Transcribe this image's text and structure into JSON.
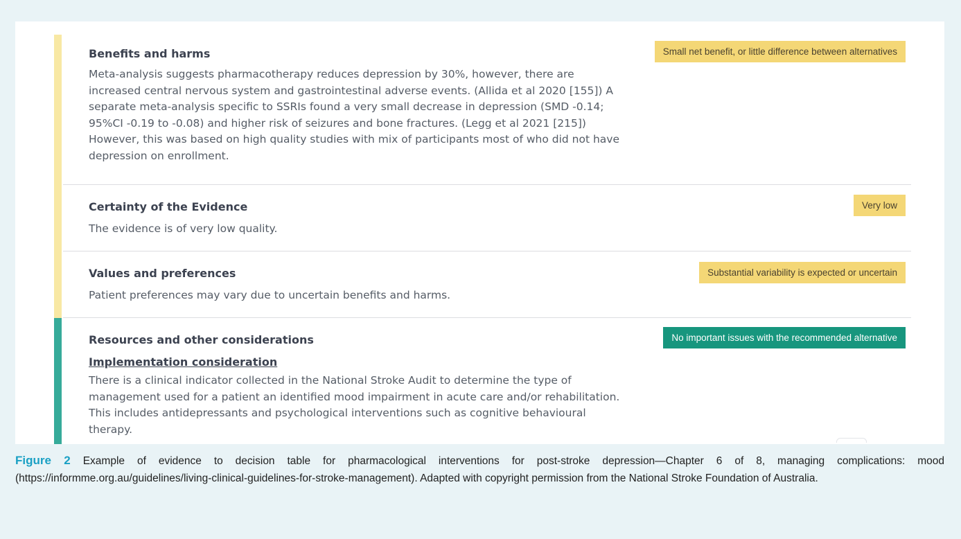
{
  "colors": {
    "yellow_bar": "#f8e8a4",
    "teal_bar": "#36ab9a",
    "yellow_badge": "#f4d776",
    "teal_badge": "#17967e",
    "caption_label": "#1aa0c4"
  },
  "sections": [
    {
      "title": "Benefits and harms",
      "badge": "Small net benefit, or little difference between alternatives",
      "body": "Meta-analysis suggests pharmacotherapy reduces depression by 30%, however, there are increased central nervous system and gastrointestinal adverse events. (Allida et al 2020 [155]) A separate meta-analysis specific to SSRIs found a very small decrease in depression (SMD -0.14; 95%CI -0.19 to -0.08) and higher risk of seizures and bone fractures. (Legg et al 2021 [215]) However, this was based on high quality studies with mix of participants most of who did not have depression on enrollment."
    },
    {
      "title": "Certainty of the Evidence",
      "badge": "Very low",
      "body": "The evidence is of very low quality."
    },
    {
      "title": "Values and preferences",
      "badge": "Substantial variability is expected or uncertain",
      "body": "Patient preferences may vary due to uncertain benefits and harms."
    },
    {
      "title": "Resources and other considerations",
      "badge": "No important issues with the recommended alternative",
      "subtitle": "Implementation consideration",
      "body": "There is a clinical indicator collected in the National Stroke Audit to determine the type of management used for a patient an identified mood impairment in acute care and/or rehabilitation. This includes antidepressants and psychological interventions such as cognitive behavioural therapy."
    }
  ],
  "caption": {
    "label": "Figure 2",
    "text": "Example of evidence to decision table for pharmacological interventions for post-stroke depression—Chapter 6 of 8, managing complications: mood (https://informme.org.au/guidelines/living-clinical-guidelines-for-stroke-management). Adapted with copyright permission from the National Stroke Foundation of Australia."
  }
}
